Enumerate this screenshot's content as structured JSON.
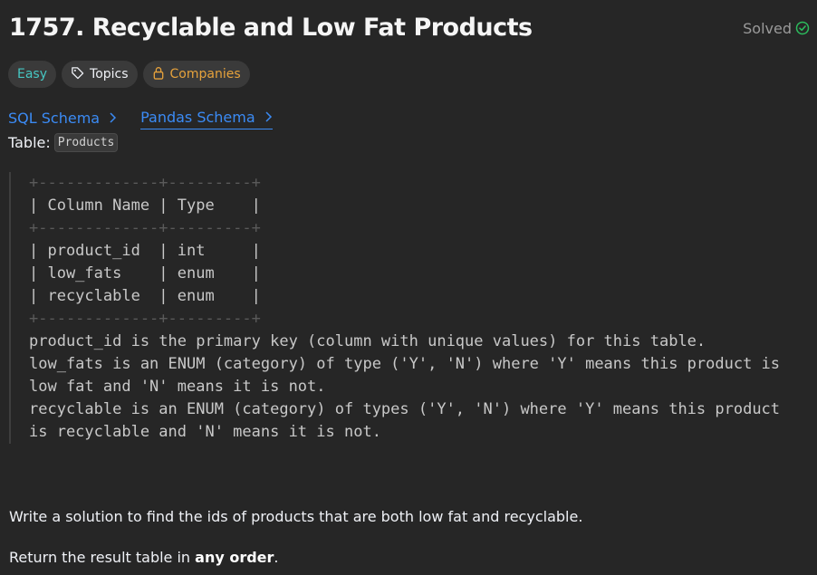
{
  "problem": {
    "title": "1757. Recyclable and Low Fat Products",
    "status_label": "Solved",
    "status_color": "#2cbb5d"
  },
  "tags": {
    "difficulty": "Easy",
    "topics": "Topics",
    "companies": "Companies",
    "difficulty_color": "#46c6c2",
    "companies_color": "#e6a23c"
  },
  "schema_tabs": [
    {
      "label": "SQL Schema",
      "icon": "chevron-right-icon"
    },
    {
      "label": "Pandas Schema",
      "icon": "chevron-right-icon",
      "active": true
    }
  ],
  "table": {
    "label": "Table:",
    "name": "Products"
  },
  "schema": {
    "border_top": "+-------------+---------+",
    "header_line": "| Column Name | Type    |",
    "border_mid": "+-------------+---------+",
    "rows": [
      "| product_id  | int     |",
      "| low_fats    | enum    |",
      "| recyclable  | enum    |"
    ],
    "border_bottom": "+-------------+---------+"
  },
  "description_lines": [
    "product_id is the primary key (column with unique values) for this table.",
    "low_fats is an ENUM (category) of type ('Y', 'N') where 'Y' means this product is",
    "low fat and 'N' means it is not.",
    "recyclable is an ENUM (category) of types ('Y', 'N') where 'Y' means this product",
    "is recyclable and 'N' means it is not."
  ],
  "task": {
    "instruction": "Write a solution to find the ids of products that are both low fat and recyclable.",
    "return_prefix": "Return the result table in ",
    "return_bold": "any order",
    "return_suffix": "."
  }
}
